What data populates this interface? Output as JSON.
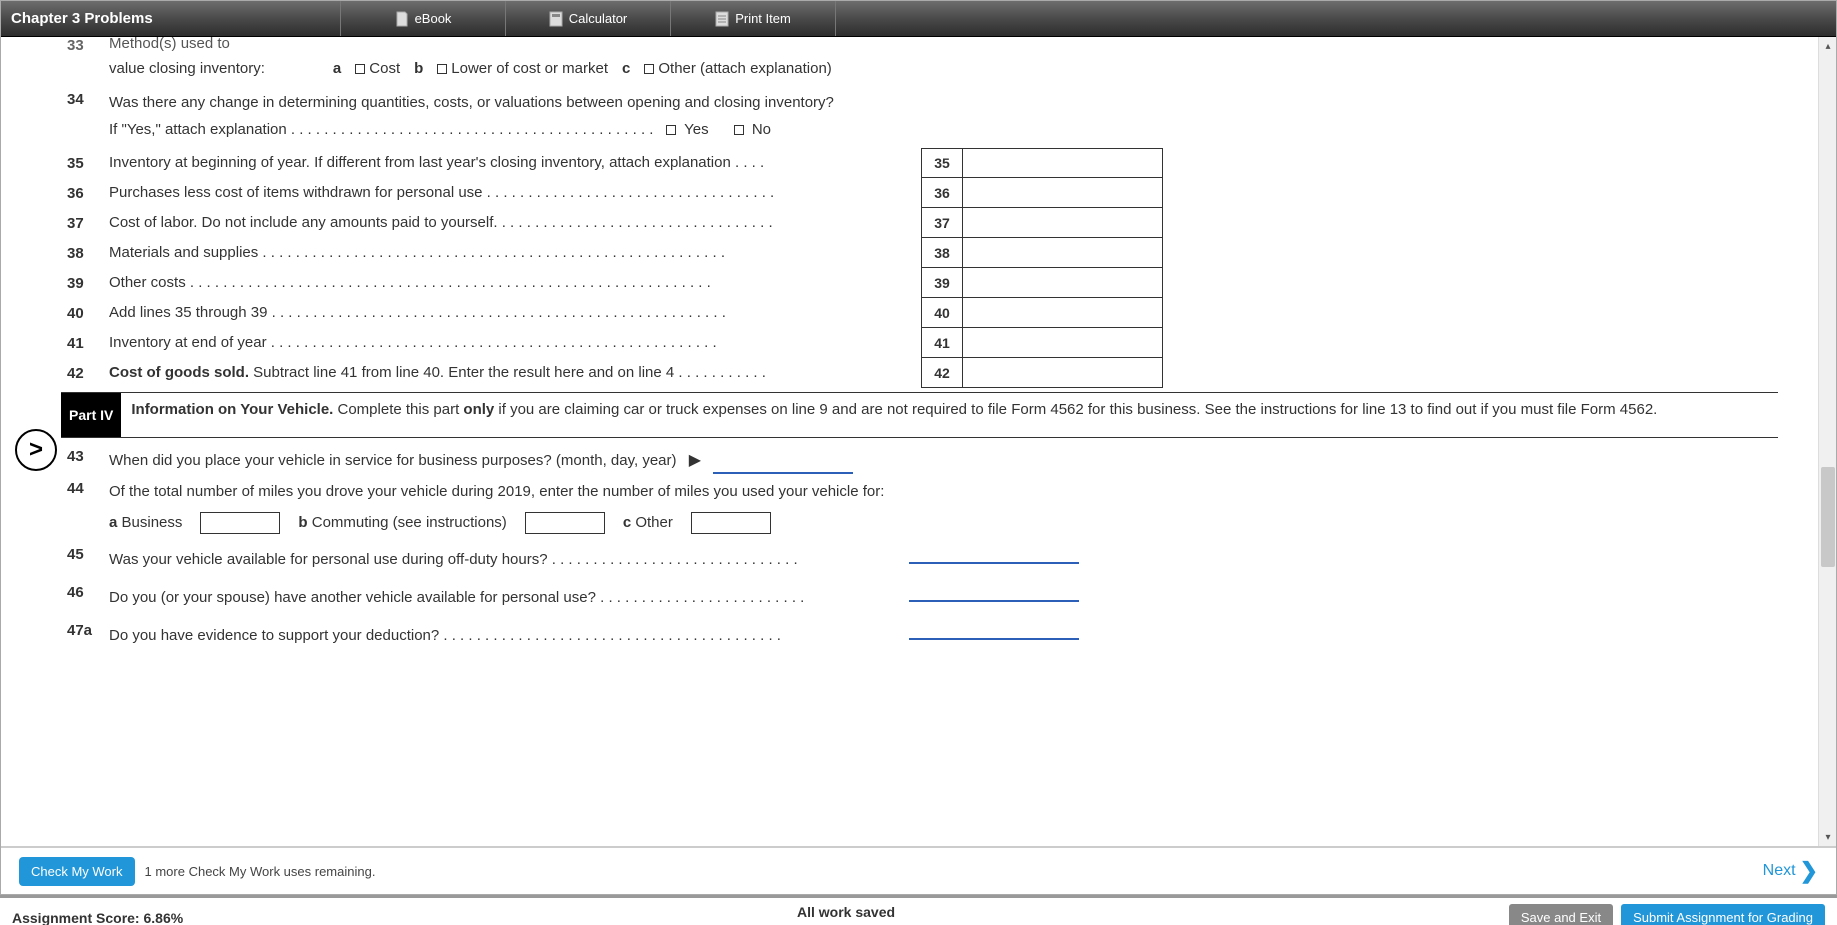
{
  "toolbar": {
    "title": "Chapter 3 Problems",
    "ebook": "eBook",
    "calculator": "Calculator",
    "print": "Print Item"
  },
  "cutoff": {
    "num": "33",
    "text": "Method(s) used to"
  },
  "line33sub": {
    "lead": "value closing inventory:",
    "a": "a",
    "a_label": "Cost",
    "b": "b",
    "b_label": "Lower of cost or market",
    "c": "c",
    "c_label": "Other (attach explanation)"
  },
  "line34": {
    "num": "34",
    "text": "Was there any change in determining quantities, costs, or valuations between opening and closing inventory?",
    "sub": "If \"Yes,\" attach explanation . . . . . . . . . . . . . . . . . . . . . . . . . . . . . . . . . . . . . . . . . . . .",
    "yes": "Yes",
    "no": "No"
  },
  "boxlines": [
    {
      "num": "35",
      "text": "Inventory at beginning of year. If different from last year's closing inventory, attach explanation . . . .",
      "rnum": "35"
    },
    {
      "num": "36",
      "text": "Purchases less cost of items withdrawn for personal use . . . . . . . . . . . . . . . . . . . . . . . . . . . . . . . . . . .",
      "rnum": "36"
    },
    {
      "num": "37",
      "text": "Cost of labor. Do not include any amounts paid to yourself. . . . . . . . . . . . . . . . . . . . . . . . . . . . . . . . . .",
      "rnum": "37"
    },
    {
      "num": "38",
      "text": "Materials and supplies . . . . . . . . . . . . . . . . . . . . . . . . . . . . . . . . . . . . . . . . . . . . . . . . . . . . . . . .",
      "rnum": "38"
    },
    {
      "num": "39",
      "text": "Other costs . . . . . . . . . . . . . . . . . . . . . . . . . . . . . . . . . . . . . . . . . . . . . . . . . . . . . . . . . . . . . . .",
      "rnum": "39"
    },
    {
      "num": "40",
      "text": "Add lines 35 through 39 . . . . . . . . . . . . . . . . . . . . . . . . . . . . . . . . . . . . . . . . . . . . . . . . . . . . . . .",
      "rnum": "40"
    },
    {
      "num": "41",
      "text": "Inventory at end of year . . . . . . . . . . . . . . . . . . . . . . . . . . . . . . . . . . . . . . . . . . . . . . . . . . . . . .",
      "rnum": "41"
    }
  ],
  "line42": {
    "num": "42",
    "lead": "Cost of goods sold.",
    "rest": " Subtract line 41 from line 40. Enter the result here and on line 4 . . . . . . . . . . .",
    "rnum": "42"
  },
  "part4": {
    "tag": "Part IV",
    "lead": "Information on Your Vehicle.",
    "mid1": " Complete this part ",
    "only": "only",
    "mid2": " if you are claiming car or truck expenses on line 9 and are not required to file Form 4562 for this business. See the instructions for line 13 to find out if you must file Form 4562."
  },
  "line43": {
    "num": "43",
    "text": "When did you place your vehicle in service for business purposes? (month, day, year)"
  },
  "line44": {
    "num": "44",
    "text": "Of the total number of miles you drove your vehicle during 2019, enter the number of miles you used your vehicle for:",
    "a": "a",
    "a_label": "Business",
    "b": "b",
    "b_label": "Commuting (see instructions)",
    "c": "c",
    "c_label": "Other"
  },
  "line45": {
    "num": "45",
    "text": "Was your vehicle available for personal use during off-duty hours? . . . . . . . . . . . . . . . . . . . . . . . . . . . . . ."
  },
  "line46": {
    "num": "46",
    "text": "Do you (or your spouse) have another vehicle available for personal use? . . . . . . . . . . . . . . . . . . . . . . . . ."
  },
  "line47a": {
    "num": "47a",
    "text": "Do you have evidence to support your deduction? . . . . . . . . . . . . . . . . . . . . . . . . . . . . . . . . . . . . . . . . ."
  },
  "actionbar": {
    "check": "Check My Work",
    "remaining": "1 more Check My Work uses remaining.",
    "next": "Next"
  },
  "footer": {
    "score_label": "Assignment Score: 6.86%",
    "saved": "All work saved",
    "save_exit": "Save and Exit",
    "submit": "Submit Assignment for Grading"
  }
}
